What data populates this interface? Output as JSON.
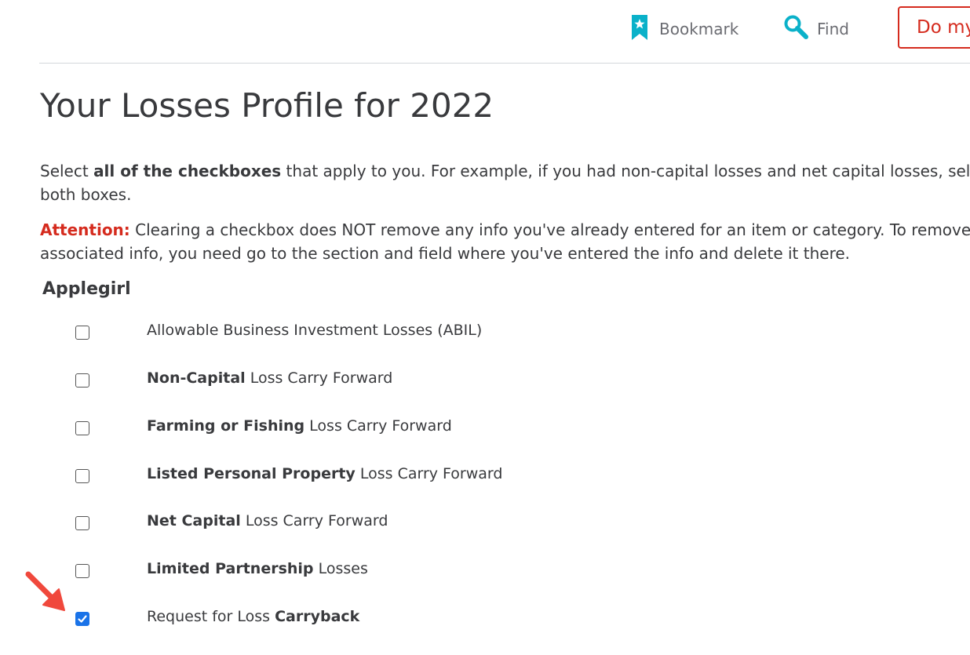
{
  "toolbar": {
    "bookmark_label": "Bookmark",
    "find_label": "Find",
    "action_button_label": "Do my"
  },
  "page": {
    "title": "Your Losses Profile for 2022",
    "intro_1": "Select ",
    "intro_bold": "all of the checkboxes",
    "intro_2": " that apply to you. For example, if you had non-capital losses and net capital losses, select both boxes.",
    "attention_label": "Attention:",
    "attention_text": " Clearing a checkbox does NOT remove any info you've already entered for an item or category. To remove associated info, you need go to the section and field where you've entered the info and delete it there.",
    "person_name": "Applegirl"
  },
  "options": [
    {
      "prefix": "Allowable Business Investment Losses (ABIL)",
      "bold": "",
      "suffix": "",
      "checked": false
    },
    {
      "prefix": "",
      "bold": "Non-Capital",
      "suffix": " Loss Carry Forward",
      "checked": false
    },
    {
      "prefix": "",
      "bold": "Farming or Fishing",
      "suffix": " Loss Carry Forward",
      "checked": false
    },
    {
      "prefix": "",
      "bold": "Listed Personal Property",
      "suffix": " Loss Carry Forward",
      "checked": false
    },
    {
      "prefix": "",
      "bold": "Net Capital",
      "suffix": " Loss Carry Forward",
      "checked": false
    },
    {
      "prefix": "",
      "bold": "Limited Partnership",
      "suffix": " Losses",
      "checked": false
    },
    {
      "prefix": "Request for Loss ",
      "bold": "Carryback",
      "suffix": "",
      "checked": true
    }
  ],
  "colors": {
    "accent_red": "#d52b1e",
    "icon_teal": "#0ab1c9",
    "checkbox_blue": "#1a73e8",
    "annotation_arrow": "#f0483c"
  },
  "icons": {
    "bookmark": "bookmark-star-icon",
    "find": "magnifier-icon",
    "checkbox_checked": "check-icon",
    "annotation": "red-arrow-icon"
  }
}
